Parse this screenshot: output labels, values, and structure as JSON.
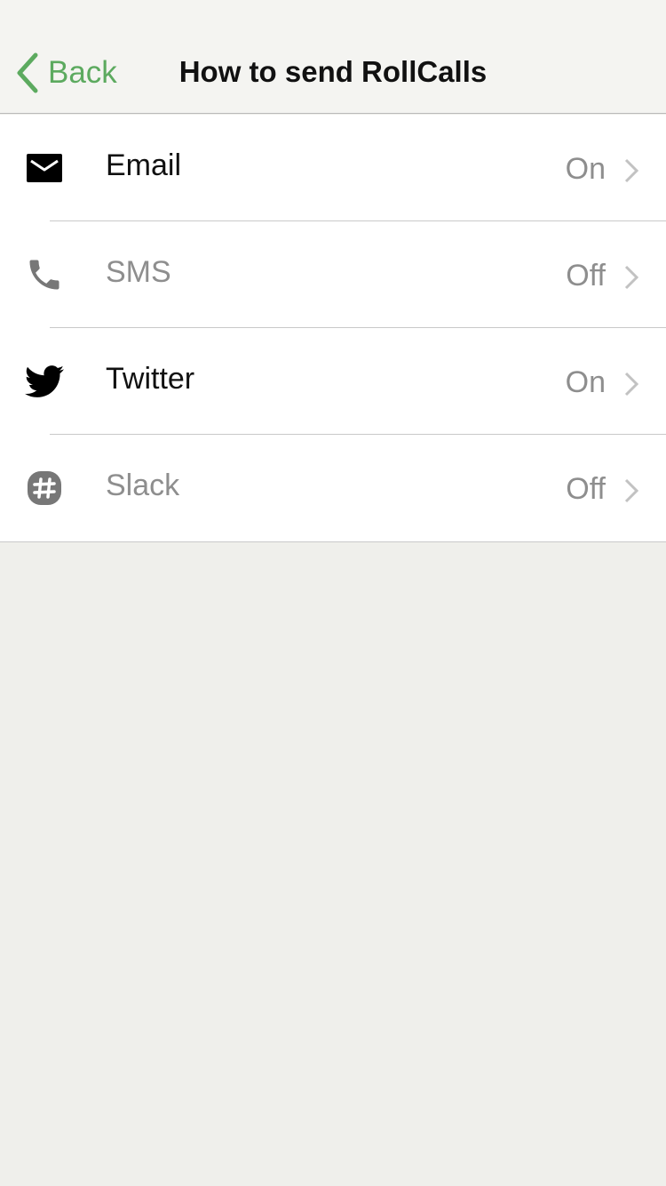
{
  "header": {
    "back_label": "Back",
    "title": "How to send RollCalls"
  },
  "colors": {
    "accent": "#5caa5f",
    "enabled_text": "#111111",
    "disabled_text": "#8e8e8e"
  },
  "channels": [
    {
      "icon": "envelope-icon",
      "label": "Email",
      "value": "On"
    },
    {
      "icon": "phone-icon",
      "label": "SMS",
      "value": "Off"
    },
    {
      "icon": "twitter-bird-icon",
      "label": "Twitter",
      "value": "On"
    },
    {
      "icon": "slack-hash-icon",
      "label": "Slack",
      "value": "Off"
    }
  ]
}
